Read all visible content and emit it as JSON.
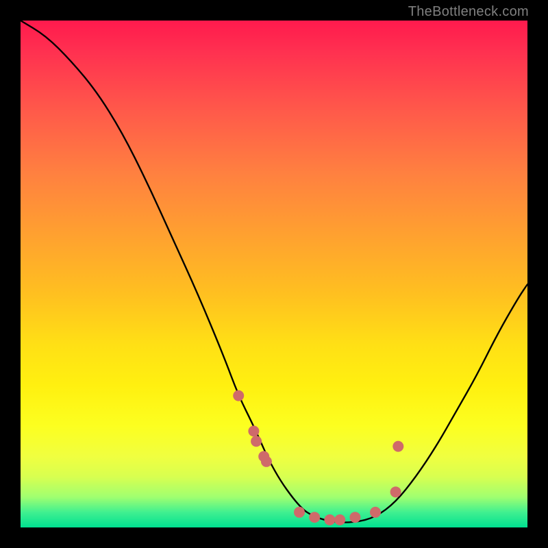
{
  "watermark": "TheBottleneck.com",
  "chart_data": {
    "type": "line",
    "title": "",
    "xlabel": "",
    "ylabel": "",
    "xlim": [
      0,
      100
    ],
    "ylim": [
      0,
      100
    ],
    "series": [
      {
        "name": "bottleneck-curve",
        "x": [
          0,
          5,
          10,
          15,
          20,
          25,
          30,
          35,
          40,
          43,
          46,
          50,
          55,
          58,
          62,
          66,
          70,
          74,
          78,
          82,
          86,
          90,
          94,
          98,
          100
        ],
        "y": [
          100,
          97,
          92,
          86,
          78,
          68,
          57,
          46,
          34,
          26,
          20,
          11,
          4,
          2,
          1,
          1,
          2,
          5,
          10,
          16,
          23,
          30,
          38,
          45,
          48
        ]
      }
    ],
    "scatter_points": {
      "name": "marked-points",
      "color": "#cf6a6a",
      "x": [
        43,
        46,
        46.5,
        48,
        48.5,
        55,
        58,
        61,
        63,
        66,
        70,
        74,
        74.5
      ],
      "y": [
        26,
        19,
        17,
        14,
        13,
        3,
        2,
        1.5,
        1.5,
        2,
        3,
        7,
        16
      ]
    },
    "background_gradient": {
      "top_color": "#ff1a4d",
      "bottom_color": "#00e090",
      "meaning": "risk-heatmap-vertical"
    }
  }
}
